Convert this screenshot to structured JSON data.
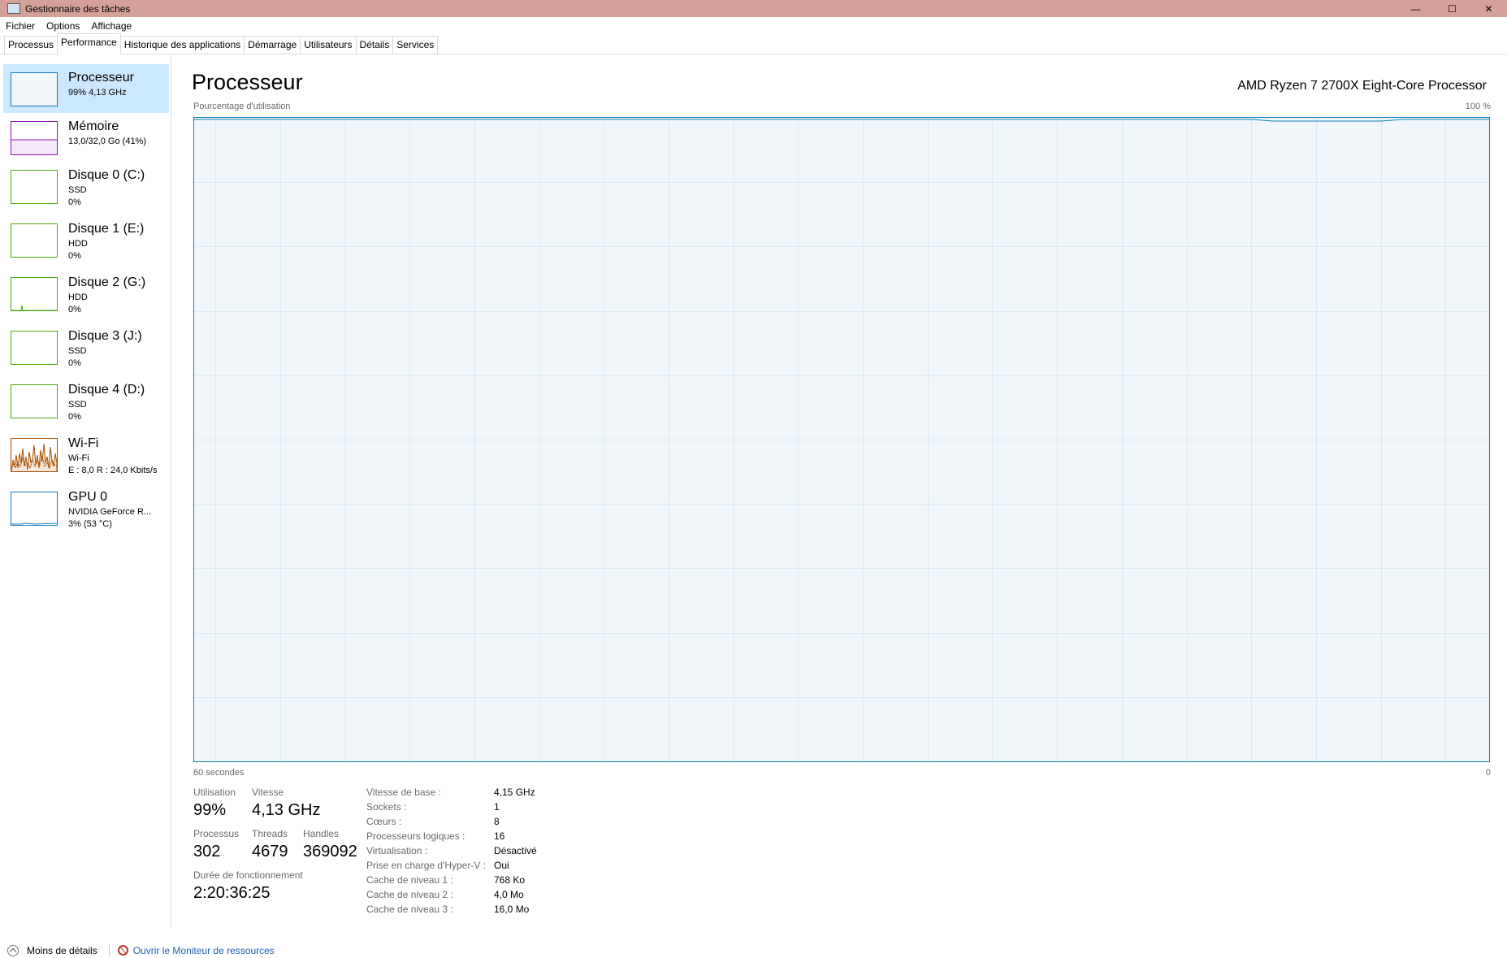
{
  "window": {
    "title": "Gestionnaire des tâches",
    "controls": {
      "minimize": "—",
      "maximize": "☐",
      "close": "✕"
    }
  },
  "menu": [
    "Fichier",
    "Options",
    "Affichage"
  ],
  "tabs": [
    {
      "label": "Processus"
    },
    {
      "label": "Performance",
      "active": true
    },
    {
      "label": "Historique des applications"
    },
    {
      "label": "Démarrage"
    },
    {
      "label": "Utilisateurs"
    },
    {
      "label": "Détails"
    },
    {
      "label": "Services"
    }
  ],
  "sidebar": {
    "items": [
      {
        "name": "Processeur",
        "sub1": "99% 4,13 GHz",
        "sub2": "",
        "color": "#117dbb",
        "icon": "cpu-graph-icon"
      },
      {
        "name": "Mémoire",
        "sub1": "13,0/32,0 Go (41%)",
        "sub2": "",
        "color": "#8b12ae",
        "icon": "memory-graph-icon"
      },
      {
        "name": "Disque 0 (C:)",
        "sub1": "SSD",
        "sub2": "0%",
        "color": "#4da60c",
        "icon": "disk-graph-icon"
      },
      {
        "name": "Disque 1 (E:)",
        "sub1": "HDD",
        "sub2": "0%",
        "color": "#4da60c",
        "icon": "disk-graph-icon"
      },
      {
        "name": "Disque 2 (G:)",
        "sub1": "HDD",
        "sub2": "0%",
        "color": "#4da60c",
        "icon": "disk-graph-icon"
      },
      {
        "name": "Disque 3 (J:)",
        "sub1": "SSD",
        "sub2": "0%",
        "color": "#4da60c",
        "icon": "disk-graph-icon"
      },
      {
        "name": "Disque 4 (D:)",
        "sub1": "SSD",
        "sub2": "0%",
        "color": "#4da60c",
        "icon": "disk-graph-icon"
      },
      {
        "name": "Wi-Fi",
        "sub1": "Wi-Fi",
        "sub2": "E : 8,0 R : 24,0 Kbits/s",
        "color": "#a74f01",
        "icon": "network-graph-icon"
      },
      {
        "name": "GPU 0",
        "sub1": "NVIDIA GeForce R...",
        "sub2": "3% (53 °C)",
        "color": "#117dbb",
        "icon": "gpu-graph-icon"
      }
    ]
  },
  "main": {
    "heading": "Processeur",
    "cpu_name": "AMD Ryzen 7 2700X Eight-Core Processor",
    "graph": {
      "y_label": "Pourcentage d'utilisation",
      "y_max_label": "100 %",
      "x_label": "60 secondes",
      "x_min_label": "0",
      "line_color": "#117dbb",
      "fill_color": "#f1f6fa",
      "grid_color": "#d9eaf4"
    },
    "stats": {
      "utilisation_label": "Utilisation",
      "utilisation_value": "99%",
      "vitesse_label": "Vitesse",
      "vitesse_value": "4,13 GHz",
      "processus_label": "Processus",
      "processus_value": "302",
      "threads_label": "Threads",
      "threads_value": "4679",
      "handles_label": "Handles",
      "handles_value": "369092",
      "uptime_label": "Durée de fonctionnement",
      "uptime_value": "2:20:36:25"
    },
    "info": [
      {
        "label": "Vitesse de base :",
        "value": "4,15 GHz"
      },
      {
        "label": "Sockets :",
        "value": "1"
      },
      {
        "label": "Cœurs :",
        "value": "8"
      },
      {
        "label": "Processeurs logiques :",
        "value": "16"
      },
      {
        "label": "Virtualisation :",
        "value": "Désactivé"
      },
      {
        "label": "Prise en charge d'Hyper-V :",
        "value": "Oui"
      },
      {
        "label": "Cache de niveau 1 :",
        "value": "768 Ko"
      },
      {
        "label": "Cache de niveau 2 :",
        "value": "4,0 Mo"
      },
      {
        "label": "Cache de niveau 3 :",
        "value": "16,0 Mo"
      }
    ]
  },
  "footer": {
    "less_details": "Moins de détails",
    "resource_monitor": "Ouvrir le Moniteur de ressources"
  }
}
